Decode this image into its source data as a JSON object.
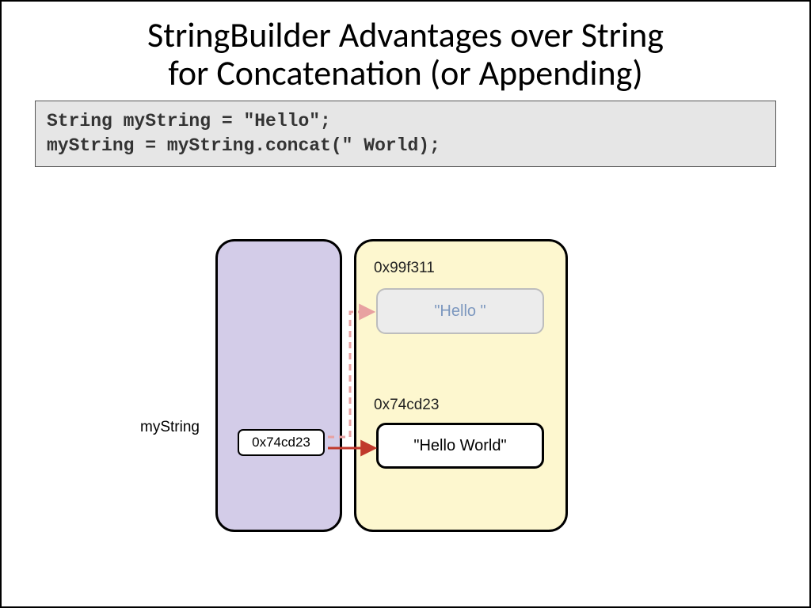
{
  "title_line1": "StringBuilder Advantages over String",
  "title_line2": "for Concatenation (or Appending)",
  "code": "String myString = \"Hello\";\nmyString = myString.concat(\" World);",
  "var_label": "myString",
  "pointer_value": "0x74cd23",
  "heap": {
    "addr_old": "0x99f311",
    "obj_old": "\"Hello \"",
    "addr_new": "0x74cd23",
    "obj_new": "\"Hello World\""
  }
}
